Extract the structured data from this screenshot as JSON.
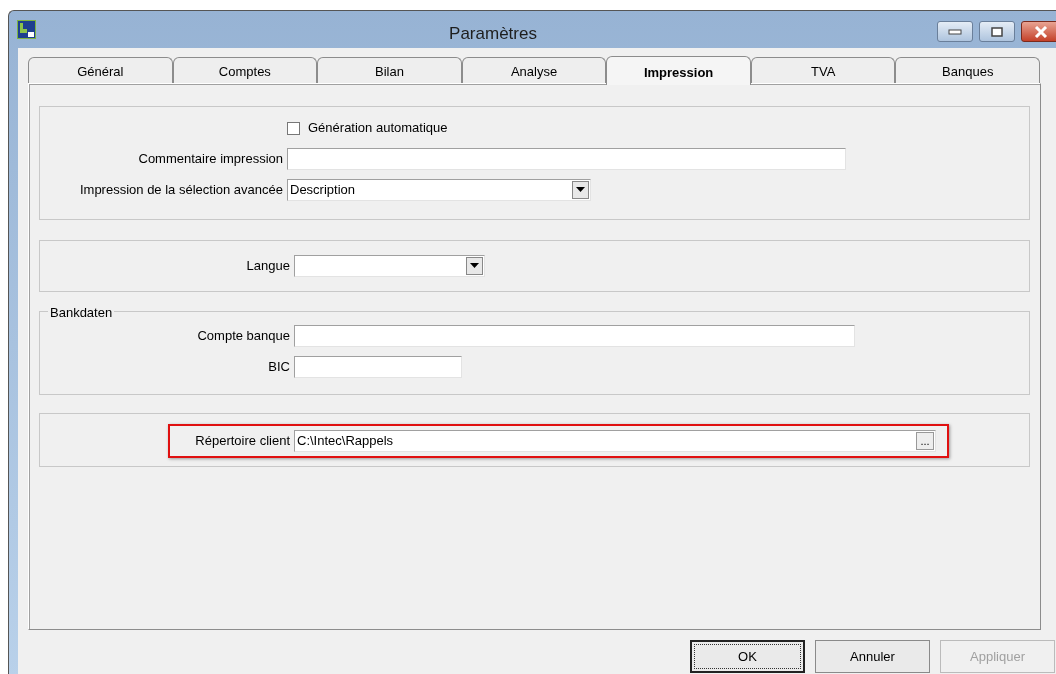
{
  "window": {
    "title": "Paramètres"
  },
  "tabs": [
    {
      "label": "Général",
      "selected": false
    },
    {
      "label": "Comptes",
      "selected": false
    },
    {
      "label": "Bilan",
      "selected": false
    },
    {
      "label": "Analyse",
      "selected": false
    },
    {
      "label": "Impression",
      "selected": true
    },
    {
      "label": "TVA",
      "selected": false
    },
    {
      "label": "Banques",
      "selected": false
    }
  ],
  "sections": [
    {
      "fields": [
        {
          "kind": "checkbox",
          "label": "Génération automatique",
          "checked": false
        },
        {
          "kind": "text",
          "label": "Commentaire impression"
        },
        {
          "kind": "select",
          "label": "Impression de la sélection avancée",
          "value": "Description"
        }
      ]
    },
    {
      "fields": [
        {
          "kind": "select",
          "label": "Langue"
        }
      ]
    },
    {
      "legend": "Bankdaten",
      "fields": [
        {
          "kind": "text",
          "label": "Compte banque"
        },
        {
          "kind": "text",
          "label": "BIC"
        }
      ]
    },
    {
      "fields": [
        {
          "kind": "path",
          "label": "Répertoire client",
          "value": "C:\\Intec\\Rappels",
          "browse": "...",
          "highlighted": true
        }
      ]
    }
  ],
  "buttons": [
    {
      "label": "OK",
      "default": true,
      "disabled": false
    },
    {
      "label": "Annuler",
      "default": false,
      "disabled": false
    },
    {
      "label": "Appliquer",
      "default": false,
      "disabled": true
    }
  ]
}
